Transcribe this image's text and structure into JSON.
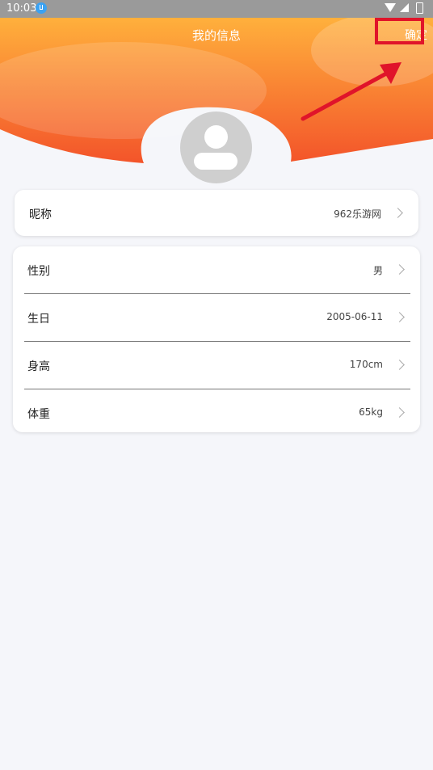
{
  "status": {
    "time": "10:03"
  },
  "header": {
    "title": "我的信息",
    "confirm_label": "确定"
  },
  "nickname": {
    "label": "昵称",
    "value": "962乐游网"
  },
  "profile": [
    {
      "label": "性别",
      "value": "男"
    },
    {
      "label": "生日",
      "value": "2005-06-11"
    },
    {
      "label": "身高",
      "value": "170cm"
    },
    {
      "label": "体重",
      "value": "65kg"
    }
  ],
  "colors": {
    "accent_top": "#ffad3a",
    "accent_bottom": "#f25a22",
    "annotation": "#e0142a"
  }
}
